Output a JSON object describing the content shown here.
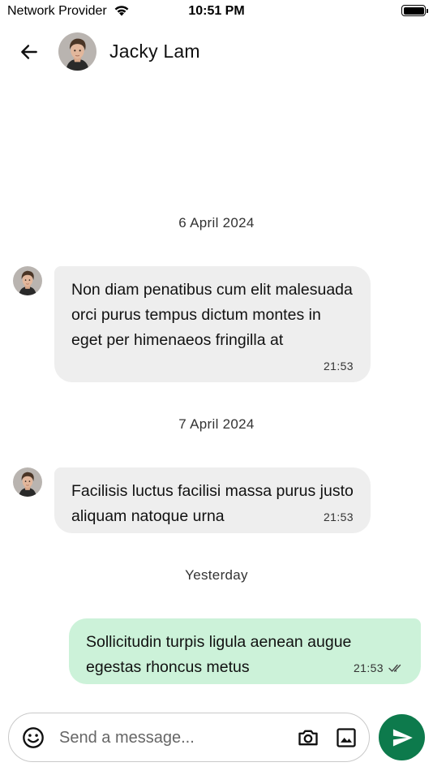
{
  "status_bar": {
    "carrier": "Network Provider",
    "time": "10:51 PM",
    "battery_level": 1.0
  },
  "header": {
    "contact_name": "Jacky Lam"
  },
  "conversation": {
    "groups": [
      {
        "date": "6 April 2024",
        "messages": [
          {
            "direction": "incoming",
            "text": "Non diam penatibus cum elit malesuada orci purus tempus dictum montes in eget per himenaeos fringilla at",
            "time": "21:53"
          }
        ]
      },
      {
        "date": "7 April 2024",
        "messages": [
          {
            "direction": "incoming",
            "text": "Facilisis luctus facilisi massa purus justo aliquam natoque urna",
            "time": "21:53"
          }
        ]
      },
      {
        "date": "Yesterday",
        "messages": [
          {
            "direction": "outgoing",
            "text": "Sollicitudin turpis ligula aenean augue egestas rhoncus metus",
            "time": "21:53",
            "status": "read"
          }
        ]
      }
    ]
  },
  "composer": {
    "placeholder": "Send a message...",
    "value": ""
  },
  "colors": {
    "incoming_bubble": "#eeeeee",
    "outgoing_bubble": "#ccf2d9",
    "send_button": "#0d7a4c"
  },
  "icons": {
    "back": "arrow-left-icon",
    "emoji": "smiley-icon",
    "camera": "camera-icon",
    "gallery": "image-icon",
    "send": "send-icon",
    "read_status": "double-check-icon",
    "wifi": "wifi-icon",
    "battery": "battery-icon"
  }
}
